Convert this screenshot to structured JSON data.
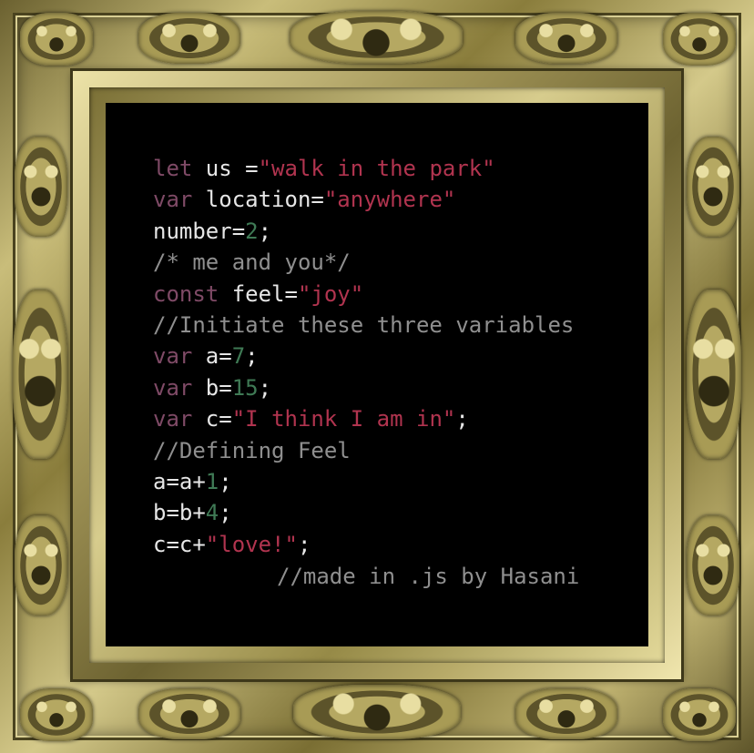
{
  "colors": {
    "keyword": "#7f4a66",
    "string": "#b1344f",
    "number": "#3f7a55",
    "comment": "#8f8f8f",
    "plain": "#e6e6e6",
    "frame_gold": "#b5a862",
    "canvas": "#000000"
  },
  "code_lines": [
    [
      {
        "t": "let",
        "c": "keyword"
      },
      {
        "t": " us =",
        "c": "plain"
      },
      {
        "t": "\"walk in the park\"",
        "c": "string"
      }
    ],
    [
      {
        "t": "var",
        "c": "keyword"
      },
      {
        "t": " location=",
        "c": "plain"
      },
      {
        "t": "\"anywhere\"",
        "c": "string"
      }
    ],
    [
      {
        "t": "number=",
        "c": "plain"
      },
      {
        "t": "2",
        "c": "number"
      },
      {
        "t": ";",
        "c": "plain"
      }
    ],
    [
      {
        "t": "/* me and you*/",
        "c": "comment"
      }
    ],
    [
      {
        "t": "const",
        "c": "keyword"
      },
      {
        "t": " feel=",
        "c": "plain"
      },
      {
        "t": "\"joy\"",
        "c": "string"
      }
    ],
    [
      {
        "t": "//Initiate these three variables",
        "c": "comment"
      }
    ],
    [
      {
        "t": "var",
        "c": "keyword"
      },
      {
        "t": " a=",
        "c": "plain"
      },
      {
        "t": "7",
        "c": "number"
      },
      {
        "t": ";",
        "c": "plain"
      }
    ],
    [
      {
        "t": "var",
        "c": "keyword"
      },
      {
        "t": " b=",
        "c": "plain"
      },
      {
        "t": "15",
        "c": "number"
      },
      {
        "t": ";",
        "c": "plain"
      }
    ],
    [
      {
        "t": "var",
        "c": "keyword"
      },
      {
        "t": " c=",
        "c": "plain"
      },
      {
        "t": "\"I think I am in\"",
        "c": "string"
      },
      {
        "t": ";",
        "c": "plain"
      }
    ],
    [
      {
        "t": "//Defining Feel",
        "c": "comment"
      }
    ],
    [
      {
        "t": "a=a+",
        "c": "plain"
      },
      {
        "t": "1",
        "c": "number"
      },
      {
        "t": ";",
        "c": "plain"
      }
    ],
    [
      {
        "t": "b=b+",
        "c": "plain"
      },
      {
        "t": "4",
        "c": "number"
      },
      {
        "t": ";",
        "c": "plain"
      }
    ],
    [
      {
        "t": "c=c+",
        "c": "plain"
      },
      {
        "t": "\"love!\"",
        "c": "string"
      },
      {
        "t": ";",
        "c": "plain"
      }
    ]
  ],
  "signature": "//made in .js by Hasani"
}
